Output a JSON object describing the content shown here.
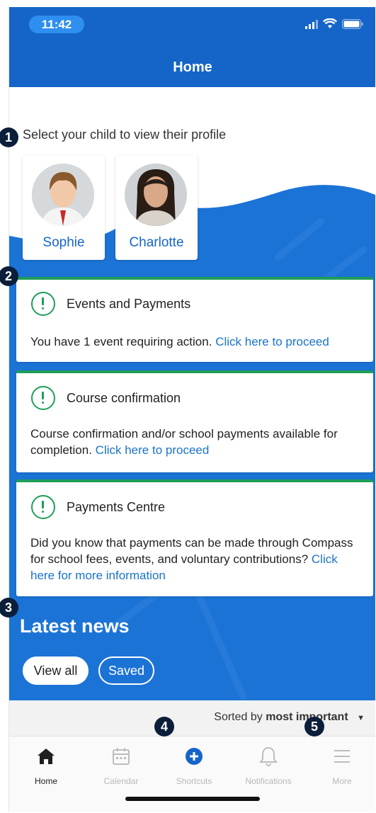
{
  "status_bar": {
    "time": "11:42"
  },
  "header": {
    "title": "Home"
  },
  "children": {
    "prompt": "Select your child to view their profile",
    "items": [
      {
        "name": "Sophie"
      },
      {
        "name": "Charlotte"
      }
    ]
  },
  "cards": [
    {
      "title": "Events and Payments",
      "body": "You have 1 event requiring action.",
      "link": "Click here to proceed"
    },
    {
      "title": "Course confirmation",
      "body": "Course confirmation and/or school payments available for completion.",
      "link": "Click here to proceed"
    },
    {
      "title": "Payments Centre",
      "body": "Did you know that payments can be made through Compass for school fees, events, and voluntary contributions?",
      "link": "Click here for more information"
    }
  ],
  "news": {
    "title": "Latest news",
    "filters": [
      {
        "label": "View all",
        "selected": true
      },
      {
        "label": "Saved",
        "selected": false
      }
    ]
  },
  "sort": {
    "prefix": "Sorted by",
    "value": "most important"
  },
  "tabs": [
    {
      "label": "Home",
      "icon": "home-icon",
      "active": true
    },
    {
      "label": "Calendar",
      "icon": "calendar-icon",
      "active": false
    },
    {
      "label": "Shortcuts",
      "icon": "plus-circle-icon",
      "active": false
    },
    {
      "label": "Notifications",
      "icon": "bell-icon",
      "active": false
    },
    {
      "label": "More",
      "icon": "menu-icon",
      "active": false
    }
  ],
  "badges": [
    "1",
    "2",
    "3",
    "4",
    "5"
  ],
  "colors": {
    "brand_blue": "#1565c8",
    "accent_green": "#1e9e5a",
    "link_blue": "#1a73c9",
    "badge_navy": "#0b1e3a"
  }
}
